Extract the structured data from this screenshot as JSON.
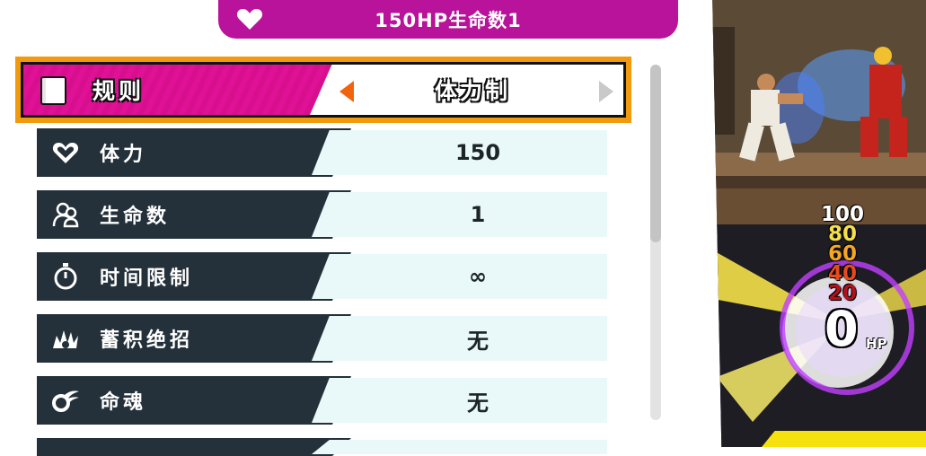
{
  "header": {
    "title": "150HP生命数1",
    "icon": "heart-icon"
  },
  "selected_rule": {
    "label": "规则",
    "value": "体力制",
    "icon": "book-icon"
  },
  "settings": [
    {
      "label": "体力",
      "value": "150",
      "icon": "heart-outline-icon"
    },
    {
      "label": "生命数",
      "value": "1",
      "icon": "stock-silhouette-icon"
    },
    {
      "label": "时间限制",
      "value": "∞",
      "icon": "stopwatch-icon"
    },
    {
      "label": "蓄积绝招",
      "value": "无",
      "icon": "meter-burst-icon"
    },
    {
      "label": "命魂",
      "value": "无",
      "icon": "spirit-icon"
    }
  ],
  "preview": {
    "hp_levels": [
      "100",
      "80",
      "60",
      "40",
      "20"
    ],
    "hp_current": "0",
    "hp_unit": "HP"
  },
  "colors": {
    "header": "#b8139a",
    "selected_highlight": "#f29a0d",
    "selected_label_bg": "#e01196",
    "row_label_bg": "#24313a",
    "row_value_bg": "#e9f8f8",
    "hp_100": "#ffffff",
    "hp_80": "#f5e04a",
    "hp_60": "#f5a623",
    "hp_40": "#e84a1e",
    "hp_20": "#b3121b"
  }
}
